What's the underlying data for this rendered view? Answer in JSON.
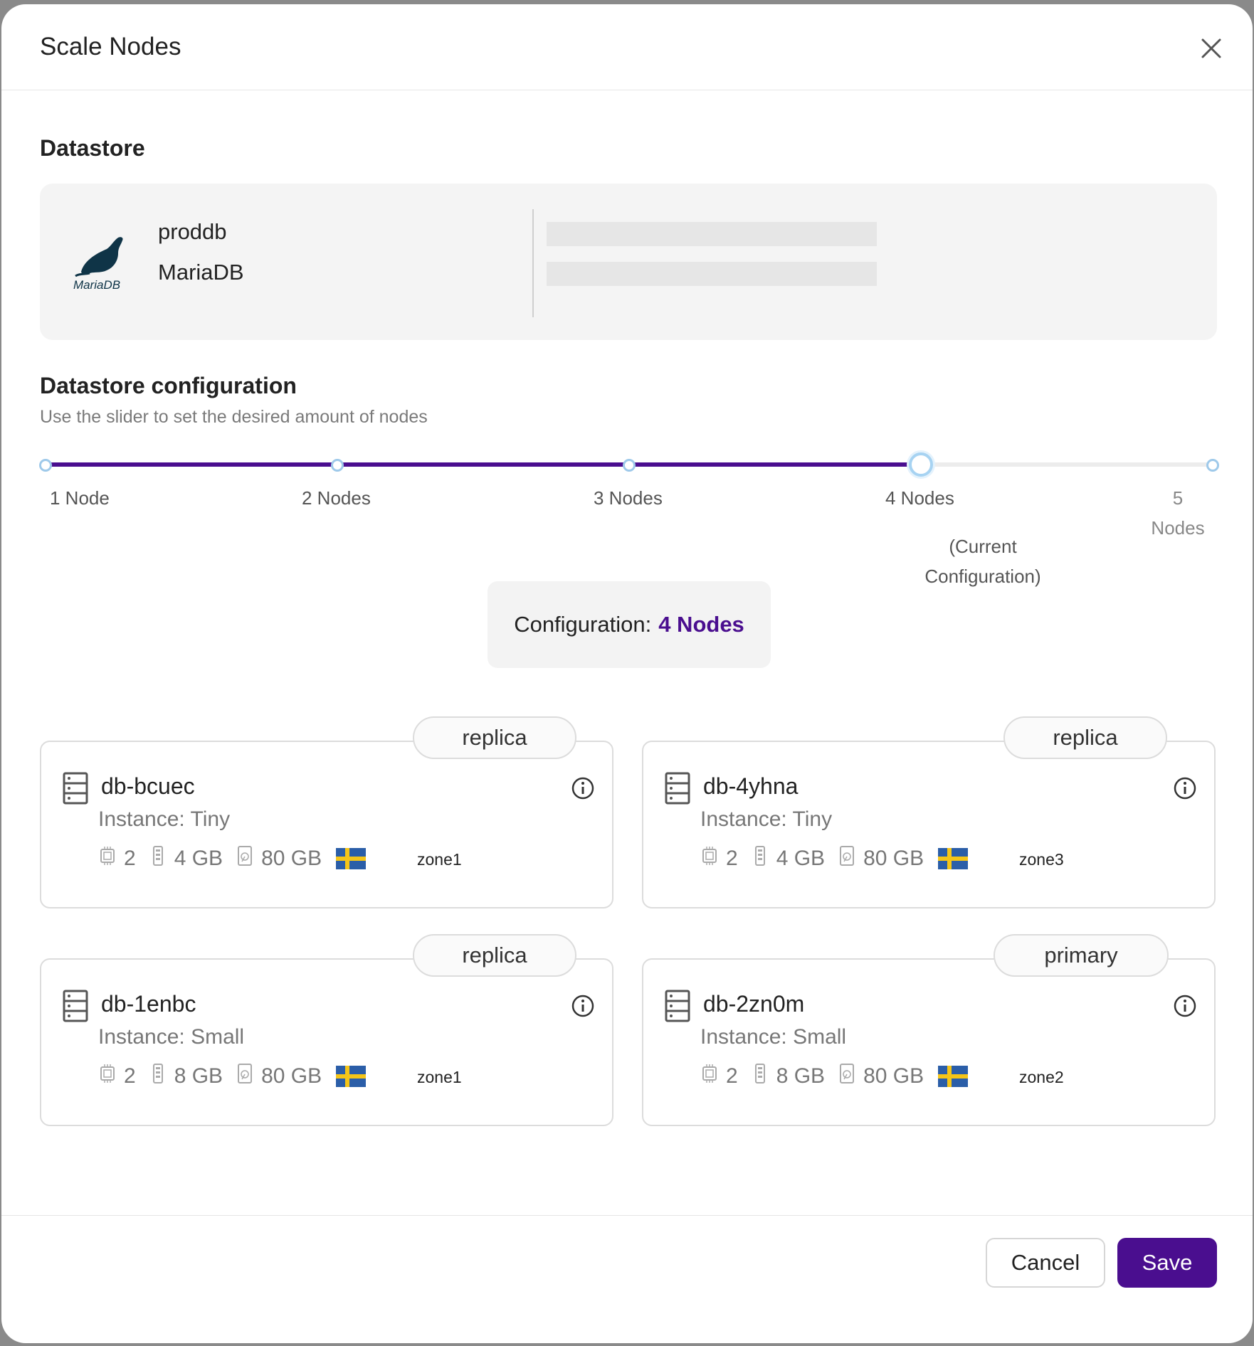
{
  "modal": {
    "title": "Scale Nodes"
  },
  "datastore": {
    "section_title": "Datastore",
    "logo_text": "MariaDB",
    "name": "proddb",
    "engine": "MariaDB"
  },
  "configuration": {
    "section_title": "Datastore configuration",
    "subtitle": "Use the slider to set the desired amount of nodes",
    "slider": {
      "selected_index": 3,
      "steps": [
        "1 Node",
        "2 Nodes",
        "3 Nodes",
        "4 Nodes",
        "5 Nodes"
      ],
      "step_5_line1": "5",
      "step_5_line2": "Nodes",
      "current_line1": "(Current",
      "current_line2": "Configuration)"
    },
    "summary_label": "Configuration:",
    "summary_value": "4 Nodes"
  },
  "nodes": [
    {
      "role": "replica",
      "name": "db-bcuec",
      "instance": "Instance: Tiny",
      "cpu": "2",
      "ram": "4 GB",
      "disk": "80 GB",
      "zone": "zone1"
    },
    {
      "role": "replica",
      "name": "db-4yhna",
      "instance": "Instance: Tiny",
      "cpu": "2",
      "ram": "4 GB",
      "disk": "80 GB",
      "zone": "zone3"
    },
    {
      "role": "replica",
      "name": "db-1enbc",
      "instance": "Instance: Small",
      "cpu": "2",
      "ram": "8 GB",
      "disk": "80 GB",
      "zone": "zone1"
    },
    {
      "role": "primary",
      "name": "db-2zn0m",
      "instance": "Instance: Small",
      "cpu": "2",
      "ram": "8 GB",
      "disk": "80 GB",
      "zone": "zone2"
    }
  ],
  "footer": {
    "cancel_label": "Cancel",
    "save_label": "Save"
  },
  "colors": {
    "accent": "#4a0e8f",
    "slider_dot": "#9ec9ea",
    "flag_blue": "#2b5ea8",
    "flag_yellow": "#f5c518"
  }
}
